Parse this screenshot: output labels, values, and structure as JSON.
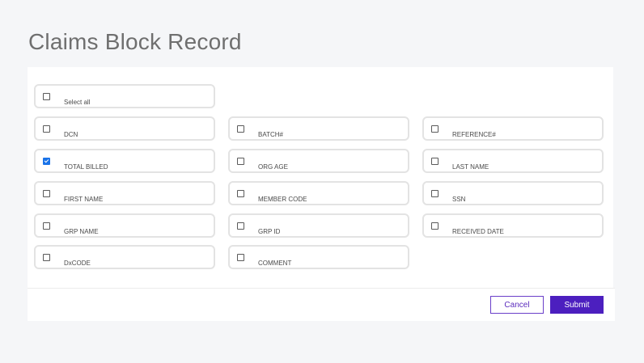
{
  "page": {
    "title": "Claims Block Record"
  },
  "options": {
    "select_all": {
      "label": "Select all",
      "checked": false
    },
    "dcn": {
      "label": "DCN",
      "checked": false
    },
    "batch": {
      "label": "BATCH#",
      "checked": false
    },
    "reference": {
      "label": "REFERENCE#",
      "checked": false
    },
    "total_billed": {
      "label": "TOTAL BILLED",
      "checked": true
    },
    "org_age": {
      "label": "ORG AGE",
      "checked": false
    },
    "last_name": {
      "label": "LAST NAME",
      "checked": false
    },
    "first_name": {
      "label": "FIRST NAME",
      "checked": false
    },
    "member_code": {
      "label": "MEMBER CODE",
      "checked": false
    },
    "ssn": {
      "label": "SSN",
      "checked": false
    },
    "grp_name": {
      "label": "GRP NAME",
      "checked": false
    },
    "grp_id": {
      "label": "GRP ID",
      "checked": false
    },
    "received_date": {
      "label": "RECEIVED DATE",
      "checked": false
    },
    "dxcode": {
      "label": "DxCODE",
      "checked": false
    },
    "comment": {
      "label": "COMMENT",
      "checked": false
    }
  },
  "actions": {
    "cancel_label": "Cancel",
    "submit_label": "Submit"
  },
  "colors": {
    "accent": "#4c1fbf",
    "checkbox_checked": "#1a73e8"
  }
}
